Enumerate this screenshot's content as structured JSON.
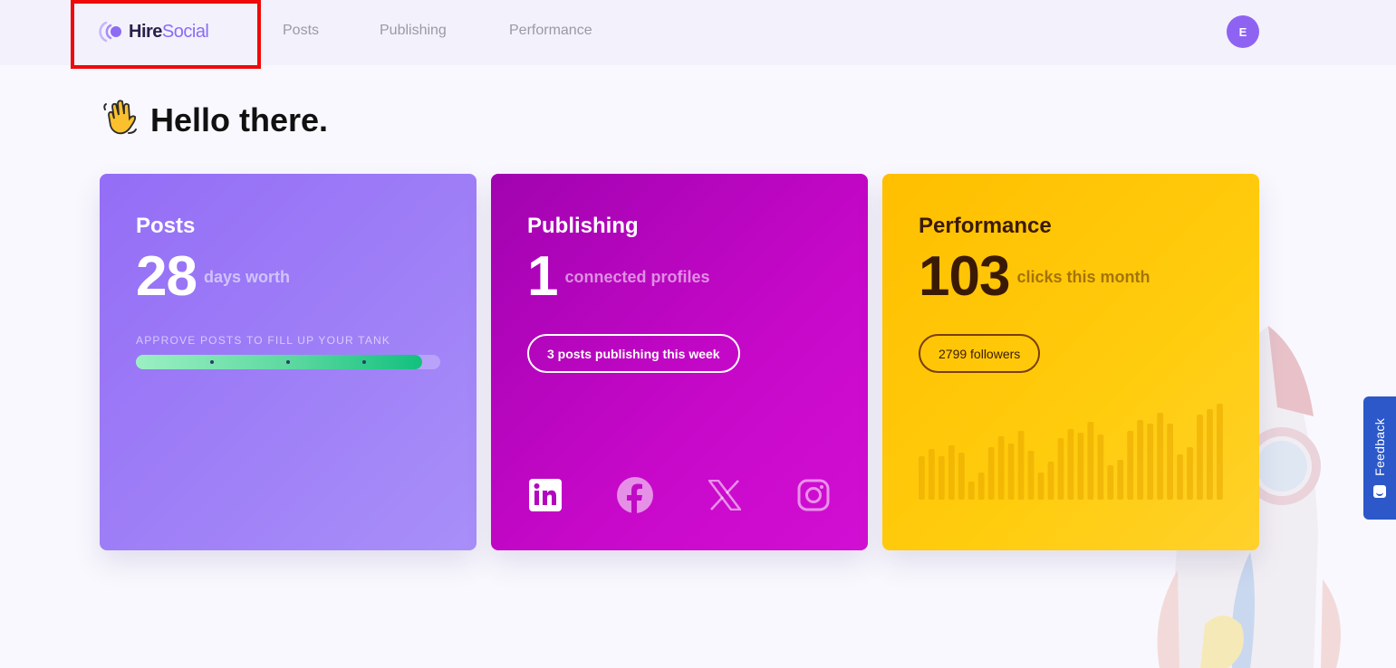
{
  "header": {
    "logo": {
      "hire": "Hire",
      "social": "Social"
    },
    "nav": [
      {
        "label": "Posts"
      },
      {
        "label": "Publishing"
      },
      {
        "label": "Performance"
      }
    ],
    "avatar_initial": "E"
  },
  "greeting": {
    "emoji": "👋",
    "title": "Hello there."
  },
  "cards": {
    "posts": {
      "title": "Posts",
      "value": "28",
      "label": "days worth",
      "tank_label": "APPROVE POSTS TO FILL UP YOUR TANK",
      "tank_fill_fraction": 0.94
    },
    "publishing": {
      "title": "Publishing",
      "value": "1",
      "label": "connected profiles",
      "pill": "3 posts publishing this week",
      "profiles": [
        {
          "icon": "linkedin-icon",
          "connected": true
        },
        {
          "icon": "facebook-icon",
          "connected": false
        },
        {
          "icon": "x-icon",
          "connected": false
        },
        {
          "icon": "instagram-icon",
          "connected": false
        }
      ]
    },
    "performance": {
      "title": "Performance",
      "value": "103",
      "label": "clicks this month",
      "pill": "2799 followers",
      "activity_bars": [
        48,
        56,
        48,
        60,
        52,
        20,
        30,
        58,
        70,
        62,
        76,
        54,
        30,
        42,
        68,
        78,
        74,
        86,
        72,
        38,
        44,
        76,
        88,
        84,
        96,
        84,
        50,
        58,
        94,
        100,
        106
      ]
    }
  },
  "feedback": {
    "label": "Feedback"
  },
  "colors": {
    "posts_card": "#946df6",
    "publishing_card": "#b005bd",
    "performance_card": "#ffc400",
    "avatar": "#8e63f2",
    "feedback_tab": "#2c58c9",
    "highlight_box": "#ee0a0a"
  }
}
